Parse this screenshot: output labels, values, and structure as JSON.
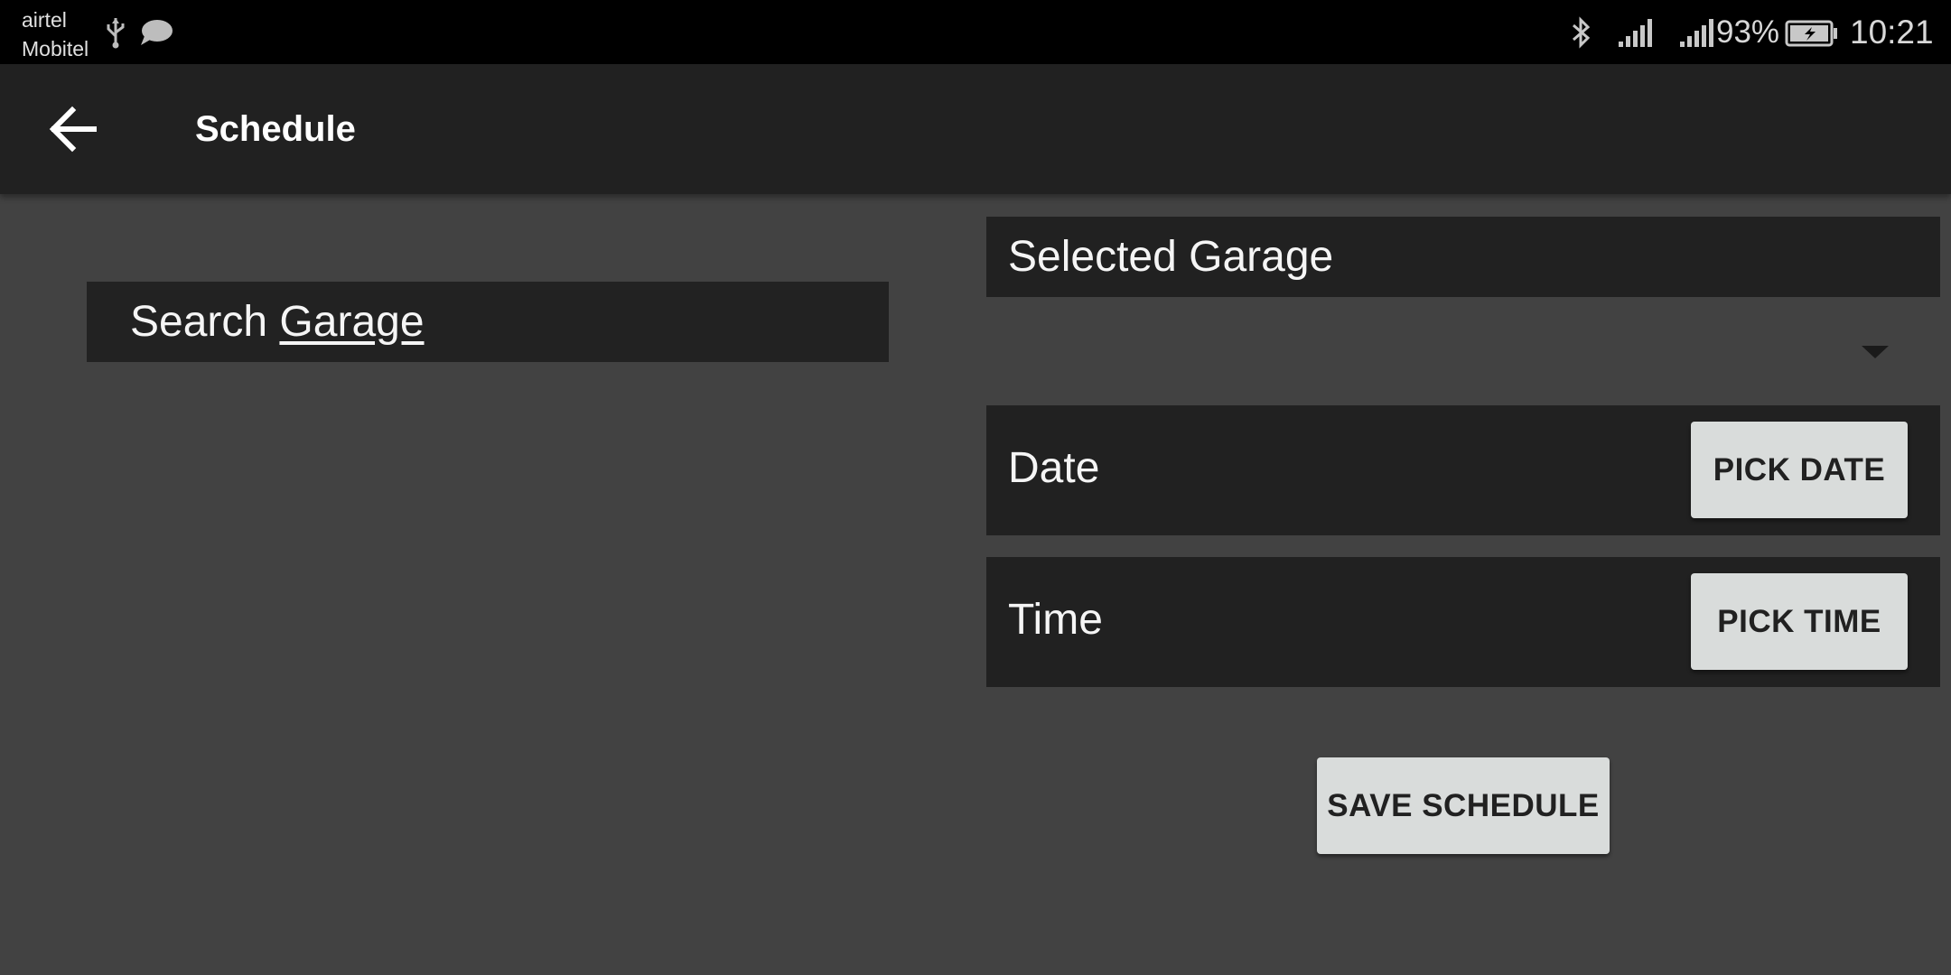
{
  "status_bar": {
    "carrier_1": "airtel",
    "carrier_2": "Mobitel",
    "battery_percent": "93%",
    "time": "10:21"
  },
  "toolbar": {
    "title": "Schedule"
  },
  "search": {
    "text_prefix": "Search ",
    "text_underlined": "Garage"
  },
  "form": {
    "selected_garage_label": "Selected Garage",
    "selected_garage_value": "",
    "date_label": "Date",
    "pick_date_label": "PICK DATE",
    "time_label": "Time",
    "pick_time_label": "PICK TIME",
    "save_label": "SAVE SCHEDULE"
  },
  "colors": {
    "background": "#424242",
    "surface": "#212121",
    "button": "#d9dcdb",
    "status_bar": "#000000"
  },
  "icons": [
    "back-arrow-icon",
    "usb-icon",
    "message-icon",
    "bluetooth-icon",
    "signal-icon",
    "battery-charging-icon",
    "dropdown-arrow-icon"
  ]
}
